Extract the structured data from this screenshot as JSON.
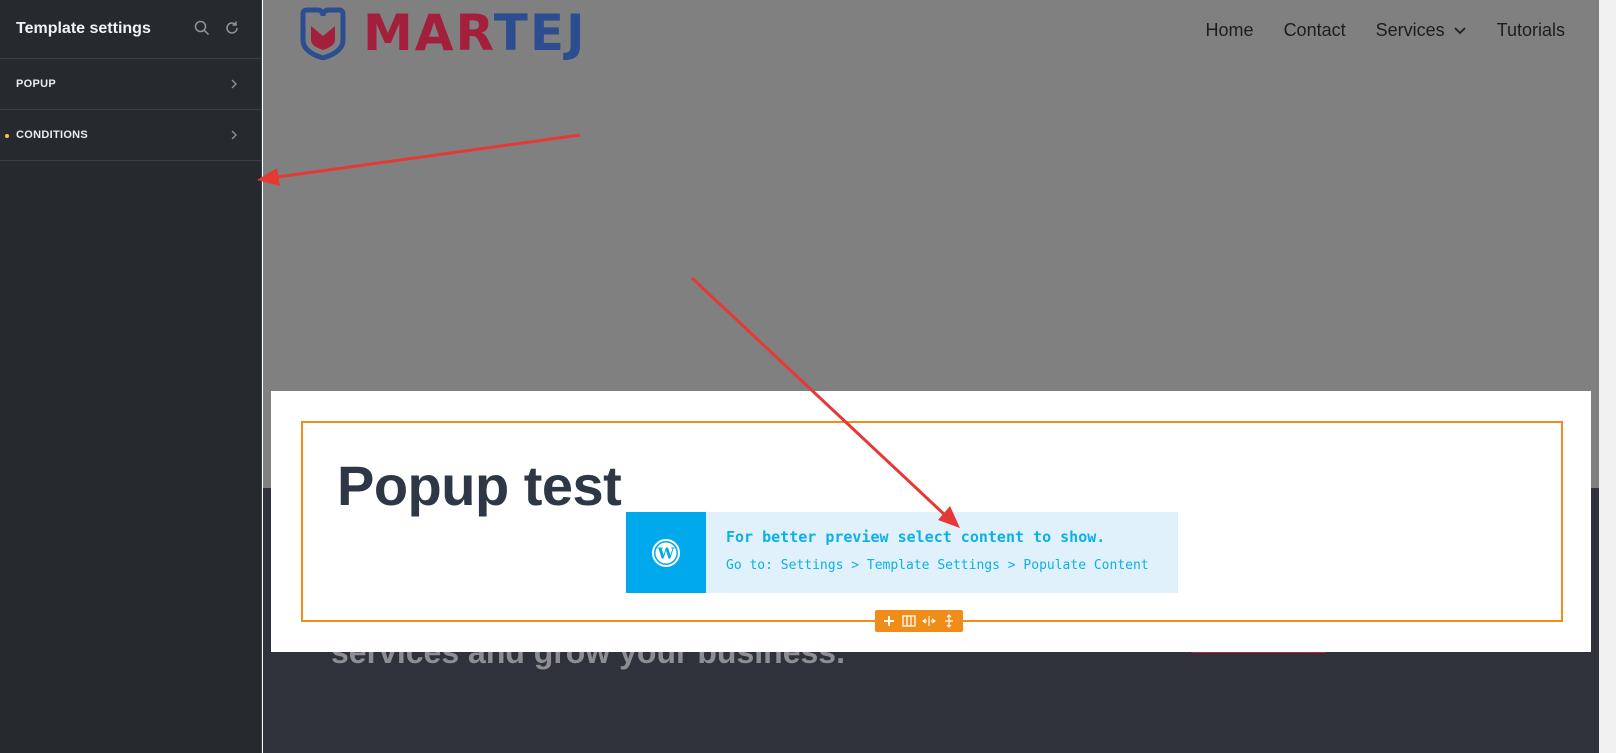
{
  "sidebar": {
    "title": "Template settings",
    "search_icon": "search-icon",
    "refresh_icon": "refresh-icon",
    "items": [
      {
        "label": "POPUP",
        "indicator": false
      },
      {
        "label": "CONDITIONS",
        "indicator": true
      }
    ]
  },
  "site": {
    "logo_part1": "MAR",
    "logo_part2": "TEJ",
    "nav": [
      {
        "label": "Home"
      },
      {
        "label": "Contact"
      },
      {
        "label": "Services",
        "dropdown": true
      },
      {
        "label": "Tutorials"
      }
    ],
    "hero_partial": "services and grow your business."
  },
  "popup": {
    "title": "Popup test",
    "notice_message": "For better preview select content to show.",
    "notice_path": "Go to: Settings > Template Settings > Populate Content",
    "toolbar_icons": [
      "plus-icon",
      "columns-icon",
      "resize-horizontal-icon",
      "move-icon"
    ]
  },
  "colors": {
    "sidebar_bg": "#262a2e",
    "accent_orange": "#f28c18",
    "arrow_red": "#e53935",
    "brand_red": "#a31f3c",
    "brand_blue": "#2c4d8f",
    "notice_blue": "#00a9ec"
  }
}
